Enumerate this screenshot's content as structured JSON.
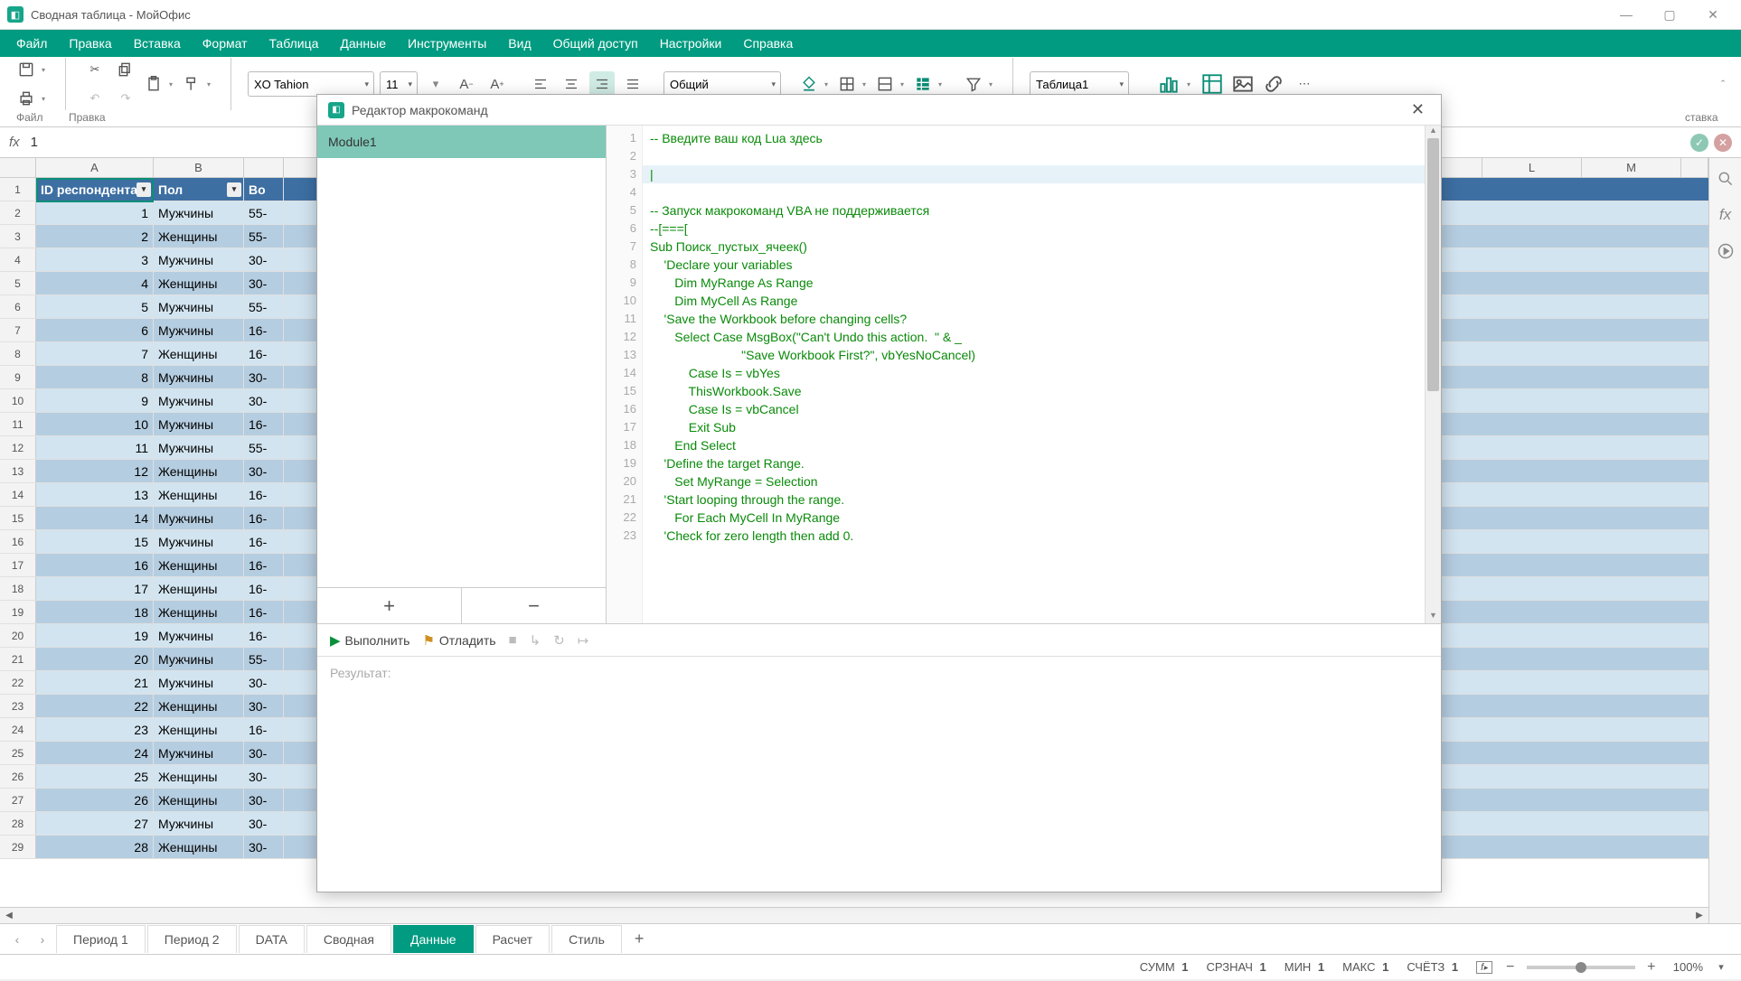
{
  "window": {
    "title": "Сводная таблица - МойОфис"
  },
  "menubar": [
    "Файл",
    "Правка",
    "Вставка",
    "Формат",
    "Таблица",
    "Данные",
    "Инструменты",
    "Вид",
    "Общий доступ",
    "Настройки",
    "Справка"
  ],
  "toolbar": {
    "file_label": "Файл",
    "edit_label": "Правка",
    "insert_label_right": "ставка",
    "font_name": "XO Tahion",
    "font_size": "11",
    "number_format": "Общий",
    "table_name": "Таблица1"
  },
  "formula": {
    "fx": "fx",
    "value": "1"
  },
  "columns": [
    "A",
    "B",
    "L",
    "M"
  ],
  "table_headers": {
    "A": "ID респондента",
    "B": "Пол",
    "C": "Во"
  },
  "rows": [
    {
      "n": 1,
      "id": "1",
      "gender": "Мужчины",
      "c": "55-"
    },
    {
      "n": 2,
      "id": "2",
      "gender": "Женщины",
      "c": "55-"
    },
    {
      "n": 3,
      "id": "3",
      "gender": "Мужчины",
      "c": "30-"
    },
    {
      "n": 4,
      "id": "4",
      "gender": "Женщины",
      "c": "30-"
    },
    {
      "n": 5,
      "id": "5",
      "gender": "Мужчины",
      "c": "55-"
    },
    {
      "n": 6,
      "id": "6",
      "gender": "Мужчины",
      "c": "16-"
    },
    {
      "n": 7,
      "id": "7",
      "gender": "Женщины",
      "c": "16-"
    },
    {
      "n": 8,
      "id": "8",
      "gender": "Мужчины",
      "c": "30-"
    },
    {
      "n": 9,
      "id": "9",
      "gender": "Мужчины",
      "c": "30-"
    },
    {
      "n": 10,
      "id": "10",
      "gender": "Мужчины",
      "c": "16-"
    },
    {
      "n": 11,
      "id": "11",
      "gender": "Мужчины",
      "c": "55-"
    },
    {
      "n": 12,
      "id": "12",
      "gender": "Женщины",
      "c": "30-"
    },
    {
      "n": 13,
      "id": "13",
      "gender": "Женщины",
      "c": "16-"
    },
    {
      "n": 14,
      "id": "14",
      "gender": "Мужчины",
      "c": "16-"
    },
    {
      "n": 15,
      "id": "15",
      "gender": "Мужчины",
      "c": "16-"
    },
    {
      "n": 16,
      "id": "16",
      "gender": "Женщины",
      "c": "16-"
    },
    {
      "n": 17,
      "id": "17",
      "gender": "Женщины",
      "c": "16-"
    },
    {
      "n": 18,
      "id": "18",
      "gender": "Женщины",
      "c": "16-"
    },
    {
      "n": 19,
      "id": "19",
      "gender": "Мужчины",
      "c": "16-"
    },
    {
      "n": 20,
      "id": "20",
      "gender": "Мужчины",
      "c": "55-"
    },
    {
      "n": 21,
      "id": "21",
      "gender": "Мужчины",
      "c": "30-"
    },
    {
      "n": 22,
      "id": "22",
      "gender": "Женщины",
      "c": "30-"
    },
    {
      "n": 23,
      "id": "23",
      "gender": "Женщины",
      "c": "16-"
    },
    {
      "n": 24,
      "id": "24",
      "gender": "Мужчины",
      "c": "30-"
    },
    {
      "n": 25,
      "id": "25",
      "gender": "Женщины",
      "c": "30-"
    },
    {
      "n": 26,
      "id": "26",
      "gender": "Женщины",
      "c": "30-"
    },
    {
      "n": 27,
      "id": "27",
      "gender": "Мужчины",
      "c": "30-"
    },
    {
      "n": 28,
      "id": "28",
      "gender": "Женщины",
      "c": "30-"
    }
  ],
  "sheet_tabs": {
    "list": [
      "Период 1",
      "Период 2",
      "DATA",
      "Сводная",
      "Данные",
      "Расчет",
      "Стиль"
    ],
    "active": "Данные"
  },
  "status": {
    "sum_label": "СУММ",
    "sum_val": "1",
    "avg_label": "СРЗНАЧ",
    "avg_val": "1",
    "min_label": "МИН",
    "min_val": "1",
    "max_label": "МАКС",
    "max_val": "1",
    "count_label": "СЧЁТЗ",
    "count_val": "1",
    "zoom": "100%"
  },
  "macro": {
    "dialog_title": "Редактор макрокоманд",
    "module_name": "Module1",
    "run_label": "Выполнить",
    "debug_label": "Отладить",
    "result_label": "Результат:",
    "gutter_start": 1,
    "gutter_end": 23,
    "code_lines": [
      "-- Введите ваш код Lua здесь",
      "",
      "|",
      "",
      "-- Запуск макрокоманд VBA не поддерживается",
      "--[===[",
      "Sub Поиск_пустых_ячеек()",
      "    'Declare your variables",
      "       Dim MyRange As Range",
      "       Dim MyCell As Range",
      "    'Save the Workbook before changing cells?",
      "       Select Case MsgBox(\"Can't Undo this action.  \" & _",
      "                          \"Save Workbook First?\", vbYesNoCancel)",
      "           Case Is = vbYes",
      "           ThisWorkbook.Save",
      "           Case Is = vbCancel",
      "           Exit Sub",
      "       End Select",
      "    'Define the target Range.",
      "       Set MyRange = Selection",
      "    'Start looping through the range.",
      "       For Each MyCell In MyRange",
      "    'Check for zero length then add 0."
    ]
  }
}
